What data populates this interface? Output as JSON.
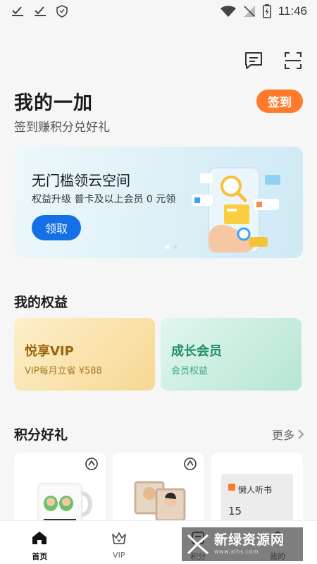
{
  "status_bar": {
    "time": "11:46"
  },
  "header": {
    "title": "我的一加",
    "subtitle": "签到赚积分兑好礼",
    "signin_label": "签到"
  },
  "banner": {
    "title": "无门槛领云空间",
    "subtitle": "权益升级 普卡及以上会员 0 元领",
    "button_label": "领取",
    "page_count": 2,
    "active_page": 1
  },
  "benefits": {
    "section_title": "我的权益",
    "cards": [
      {
        "title": "悦享VIP",
        "subtitle": "VIP每月立省 ¥588"
      },
      {
        "title": "成长会员",
        "subtitle": "会员权益"
      }
    ]
  },
  "gifts": {
    "section_title": "积分好礼",
    "more_label": "更多",
    "items": [
      {
        "name": "mug"
      },
      {
        "name": "photo-frame"
      },
      {
        "name": "audiobook",
        "label": "懒人听书",
        "badge": "15"
      }
    ]
  },
  "bottom_nav": {
    "items": [
      {
        "label": "首页",
        "icon": "home-icon",
        "active": true
      },
      {
        "label": "VIP",
        "icon": "crown-icon",
        "active": false
      },
      {
        "label": "积分",
        "icon": "points-icon",
        "active": false
      },
      {
        "label": "我的",
        "icon": "profile-icon",
        "active": false
      }
    ]
  },
  "watermark": {
    "text": "新绿资源网",
    "url": "www.xlhs.com"
  },
  "colors": {
    "accent_orange": "#ff7a2b",
    "primary_blue": "#1570e8"
  }
}
